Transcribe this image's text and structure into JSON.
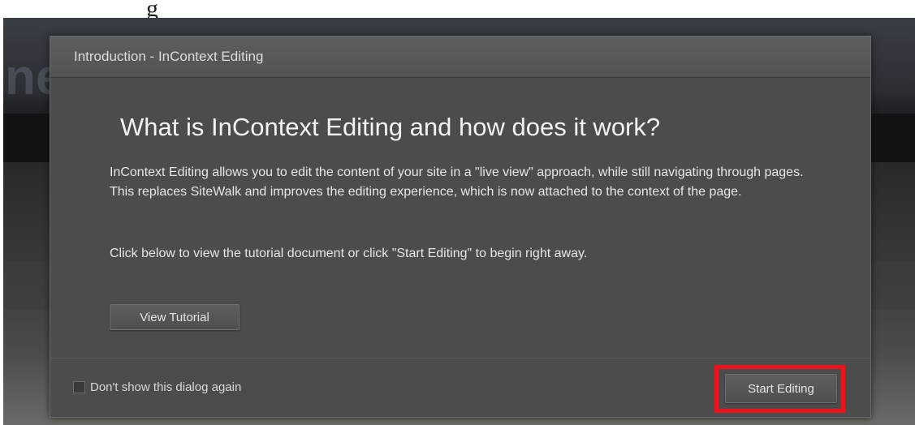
{
  "page_header_fragment": "g",
  "backdrop_fragment": "ne",
  "dialog": {
    "title": "Introduction - InContext Editing",
    "heading": "What is InContext Editing and how does it work?",
    "paragraph1": "InContext Editing allows you to edit the content of your site in a \"live view\" approach, while still navigating through pages. This replaces SiteWalk and improves the editing experience, which is now attached to the context of the page.",
    "paragraph2": "Click below to view the tutorial document or click \"Start Editing\" to begin right away.",
    "view_tutorial_label": "View Tutorial",
    "dont_show_label": "Don't show this dialog again",
    "dont_show_checked": false,
    "start_editing_label": "Start Editing"
  },
  "colors": {
    "dialog_bg": "#4c4c4c",
    "highlight_border": "#e8131c"
  }
}
